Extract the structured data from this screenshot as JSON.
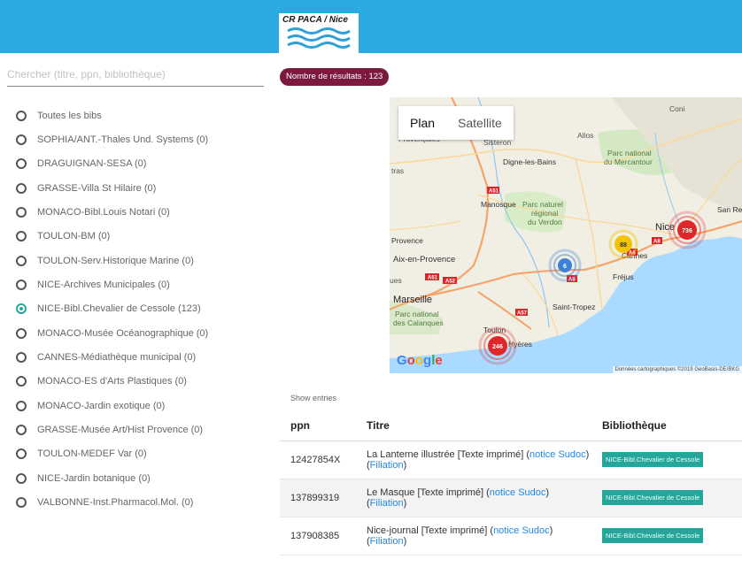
{
  "logo": {
    "text": "CR PACA / Nice"
  },
  "search": {
    "placeholder": "Chercher (titre, ppn, bibliothèque)"
  },
  "results_badge": "Nombre de résultats : 123",
  "libraries": [
    {
      "label": "Toutes les bibs",
      "checked": false
    },
    {
      "label": "SOPHIA/ANT.-Thales Und. Systems (0)",
      "checked": false
    },
    {
      "label": "DRAGUIGNAN-SESA (0)",
      "checked": false
    },
    {
      "label": "GRASSE-Villa St Hilaire (0)",
      "checked": false
    },
    {
      "label": "MONACO-Bibl.Louis Notari (0)",
      "checked": false
    },
    {
      "label": "TOULON-BM (0)",
      "checked": false
    },
    {
      "label": "TOULON-Serv.Historique Marine (0)",
      "checked": false
    },
    {
      "label": "NICE-Archives Municipales (0)",
      "checked": false
    },
    {
      "label": "NICE-Bibl.Chevalier de Cessole (123)",
      "checked": true
    },
    {
      "label": "MONACO-Musée Océanographique (0)",
      "checked": false
    },
    {
      "label": "CANNES-Médiathèque municipal (0)",
      "checked": false
    },
    {
      "label": "MONACO-ES d'Arts Plastiques (0)",
      "checked": false
    },
    {
      "label": "MONACO-Jardin exotique (0)",
      "checked": false
    },
    {
      "label": "GRASSE-Musée Art/Hist Provence (0)",
      "checked": false
    },
    {
      "label": "TOULON-MEDEF Var (0)",
      "checked": false
    },
    {
      "label": "NICE-Jardin botanique (0)",
      "checked": false
    },
    {
      "label": "VALBONNE-Inst.Pharmacol.Mol. (0)",
      "checked": false
    }
  ],
  "map": {
    "tabs": [
      "Plan",
      "Satellite"
    ],
    "active_tab": "Plan",
    "google": "Google",
    "credit": "Données cartographiques ©2019 GeoBasis-DE/BKG",
    "places": {
      "coni": "Coni",
      "provencales": "Provençales",
      "sisteron": "Sisteron",
      "allos": "Allos",
      "digne": "Digne-les-Bains",
      "mercantour1": "Parc national",
      "mercantour2": "du Mercantour",
      "tras": "tras",
      "manosque": "Manosque",
      "verdon1": "Parc naturel",
      "verdon2": "régional",
      "verdon3": "du Verdon",
      "nice": "Nice",
      "sanremo": "San Rem",
      "provence": "Provence",
      "cannes": "Cannes",
      "aix": "Aix-en-Provence",
      "frejus": "Fréjus",
      "ues": "ues",
      "marseille": "Marseille",
      "sttropez": "Saint-Tropez",
      "calanques1": "Parc national",
      "calanques2": "des Calanques",
      "toulon": "Toulon",
      "hyeres": "Hyères"
    },
    "roads": {
      "a51a": "A51",
      "a51b": "A51",
      "a52": "A52",
      "a8a": "A8",
      "a8b": "A8",
      "a8c": "A8",
      "a57": "A57"
    },
    "clusters": {
      "c736": "736",
      "c88": "88",
      "c6": "6",
      "c246": "246"
    },
    "colors": {
      "land": "#f1eee4",
      "sea": "#aadaff",
      "cluster_red": "#e0262b",
      "cluster_yellow": "#f3c300",
      "cluster_blue": "#3b82d6"
    }
  },
  "show_entries": "Show entries",
  "table": {
    "headers": {
      "ppn": "ppn",
      "titre": "Titre",
      "bib": "Bibliothèque"
    },
    "rows": [
      {
        "ppn": "12427854X",
        "title": "La Lanterne illustrée [Texte imprimé]",
        "notice": "notice Sudoc",
        "filiation": "Filiation",
        "bib": "NICE-Bibl.Chevalier de Cessole"
      },
      {
        "ppn": "137899319",
        "title": "Le Masque [Texte imprimé]",
        "notice": "notice Sudoc",
        "filiation": "Filiation",
        "bib": "NICE-Bibl.Chevalier de Cessole"
      },
      {
        "ppn": "137908385",
        "title": "Nice-journal [Texte imprimé]",
        "notice": "notice Sudoc",
        "filiation": "Filiation",
        "bib": "NICE-Bibl.Chevalier de Cessole"
      }
    ]
  }
}
